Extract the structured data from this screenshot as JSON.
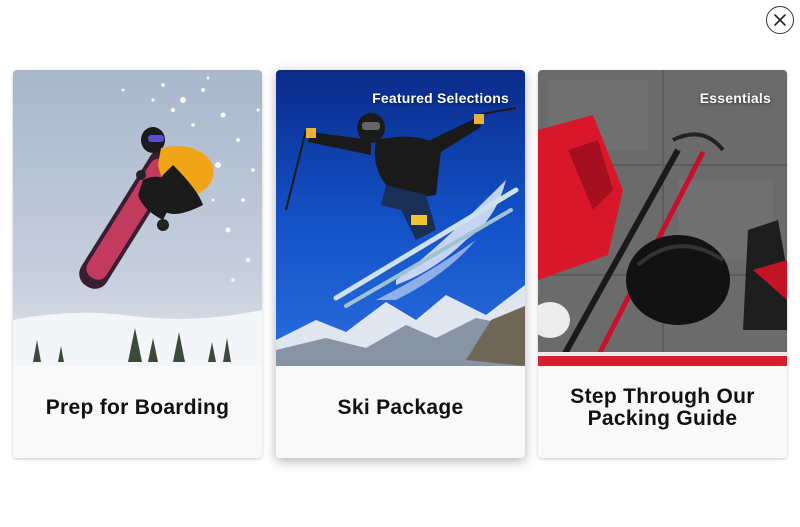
{
  "modal": {
    "close_icon": "close-icon"
  },
  "cards": [
    {
      "title": "Prep for Boarding",
      "badge": "",
      "image": "snowboarder-jump-image"
    },
    {
      "title": "Ski Package",
      "badge": "Featured Selections",
      "image": "skier-jump-image"
    },
    {
      "title": "Step Through Our Packing Guide",
      "badge": "Essentials",
      "image": "ski-gear-flatlay-image"
    }
  ]
}
